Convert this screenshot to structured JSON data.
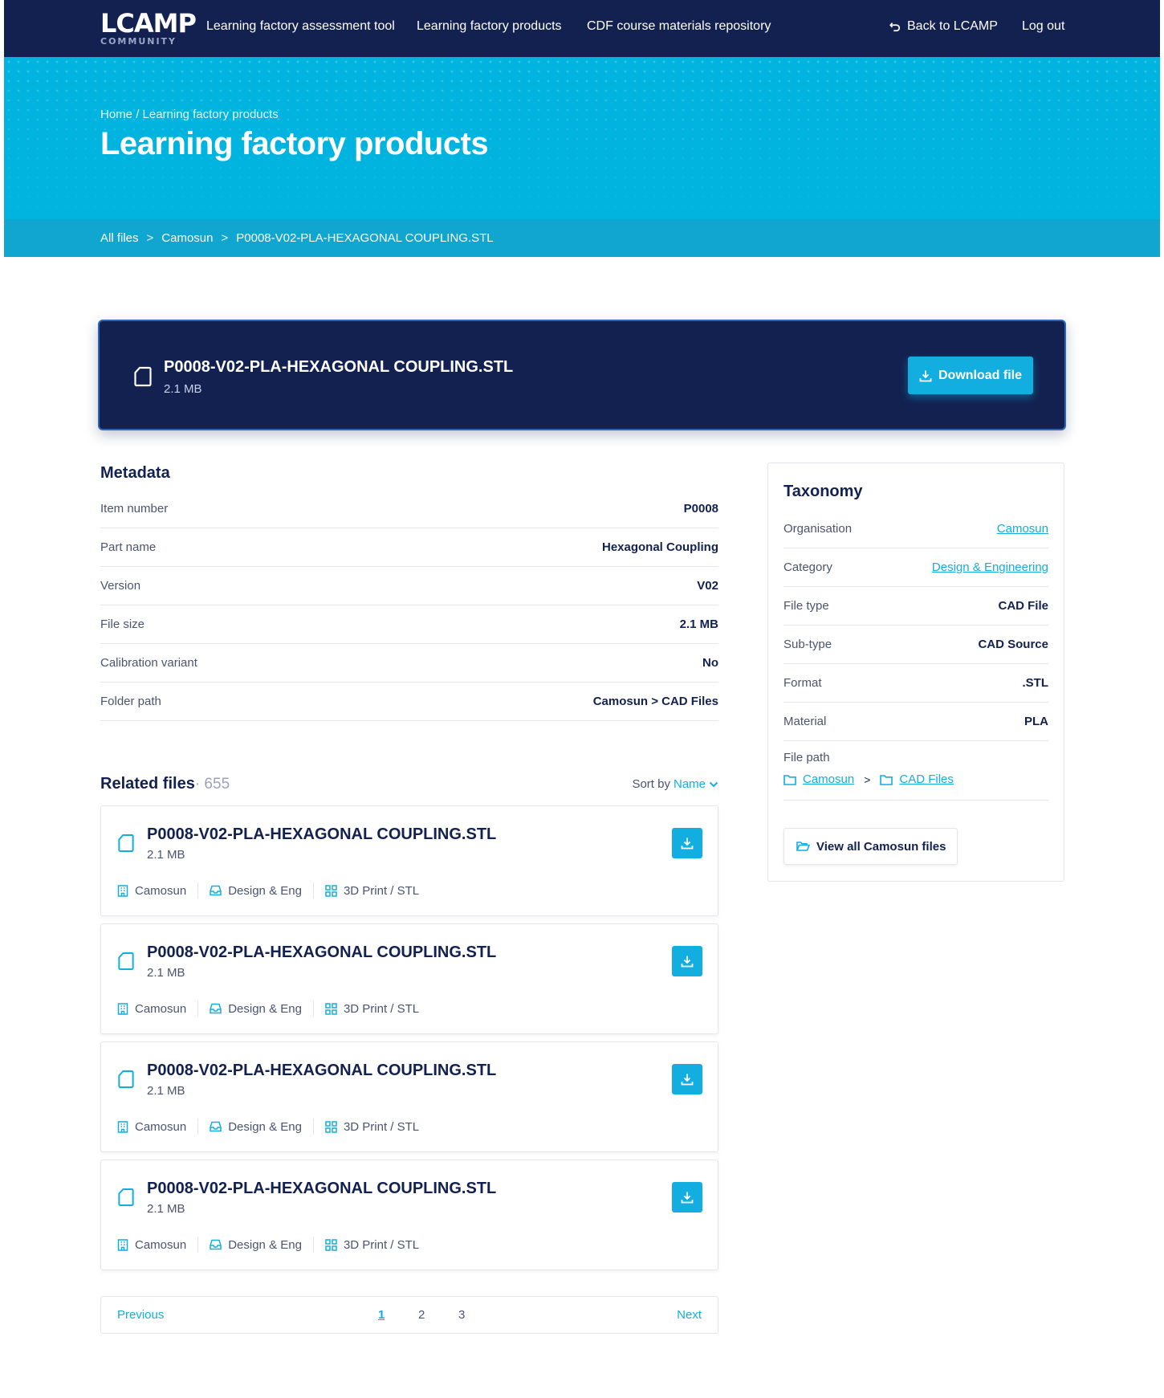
{
  "nav": {
    "logo_main": "LCAMP",
    "logo_sub": "COMMUNITY",
    "links": [
      "Learning factory assessment tool",
      "Learning factory products",
      "CDF course materials repository"
    ],
    "back_label": "Back to LCAMP",
    "logout_label": "Log out"
  },
  "hero": {
    "breadcrumb_home": "Home",
    "breadcrumb_sep": "/",
    "breadcrumb_current": "Learning factory products",
    "title": "Learning factory products"
  },
  "pathbar": {
    "items": [
      "All files",
      "Camosun",
      "P0008-V02-PLA-HEXAGONAL COUPLING.STL"
    ],
    "sep": ">"
  },
  "file": {
    "name": "P0008-V02-PLA-HEXAGONAL COUPLING.STL",
    "size": "2.1 MB",
    "download_label": "Download file"
  },
  "metadata": {
    "title": "Metadata",
    "rows": [
      {
        "label": "Item number",
        "value": "P0008"
      },
      {
        "label": "Part name",
        "value": "Hexagonal Coupling"
      },
      {
        "label": "Version",
        "value": "V02"
      },
      {
        "label": "File size",
        "value": "2.1 MB"
      },
      {
        "label": "Calibration variant",
        "value": "No"
      },
      {
        "label": "Folder path",
        "value": "Camosun > CAD Files"
      }
    ]
  },
  "taxonomy": {
    "title": "Taxonomy",
    "rows": [
      {
        "label": "Organisation",
        "value": "Camosun",
        "link": true
      },
      {
        "label": "Category",
        "value": "Design & Engineering",
        "link": true
      },
      {
        "label": "File type",
        "value": "CAD File",
        "link": false
      },
      {
        "label": "Sub-type",
        "value": "CAD Source",
        "link": false
      },
      {
        "label": "Format",
        "value": ".STL",
        "link": false
      },
      {
        "label": "Material",
        "value": "PLA",
        "link": false
      }
    ],
    "file_path_label": "File path",
    "file_path": [
      "Camosun",
      "CAD Files"
    ],
    "file_path_sep": ">",
    "view_all_label": "View all Camosun files"
  },
  "related": {
    "title": "Related files",
    "count": "· 655",
    "sort_label": "Sort by",
    "sort_value": "Name",
    "items": [
      {
        "name": "P0008-V02-PLA-HEXAGONAL COUPLING.STL",
        "size": "2.1 MB",
        "org": "Camosun",
        "category": "Design & Eng",
        "type": "3D Print / STL"
      },
      {
        "name": "P0008-V02-PLA-HEXAGONAL COUPLING.STL",
        "size": "2.1 MB",
        "org": "Camosun",
        "category": "Design & Eng",
        "type": "3D Print / STL"
      },
      {
        "name": "P0008-V02-PLA-HEXAGONAL COUPLING.STL",
        "size": "2.1 MB",
        "org": "Camosun",
        "category": "Design & Eng",
        "type": "3D Print / STL"
      },
      {
        "name": "P0008-V02-PLA-HEXAGONAL COUPLING.STL",
        "size": "2.1 MB",
        "org": "Camosun",
        "category": "Design & Eng",
        "type": "3D Print / STL"
      }
    ]
  },
  "pagination": {
    "prev_label": "Previous",
    "next_label": "Next",
    "pages": [
      "1",
      "2",
      "3"
    ],
    "current": "1"
  },
  "colors": {
    "navy": "#122150",
    "accent": "#12aee0",
    "hero": "#00b4df"
  }
}
